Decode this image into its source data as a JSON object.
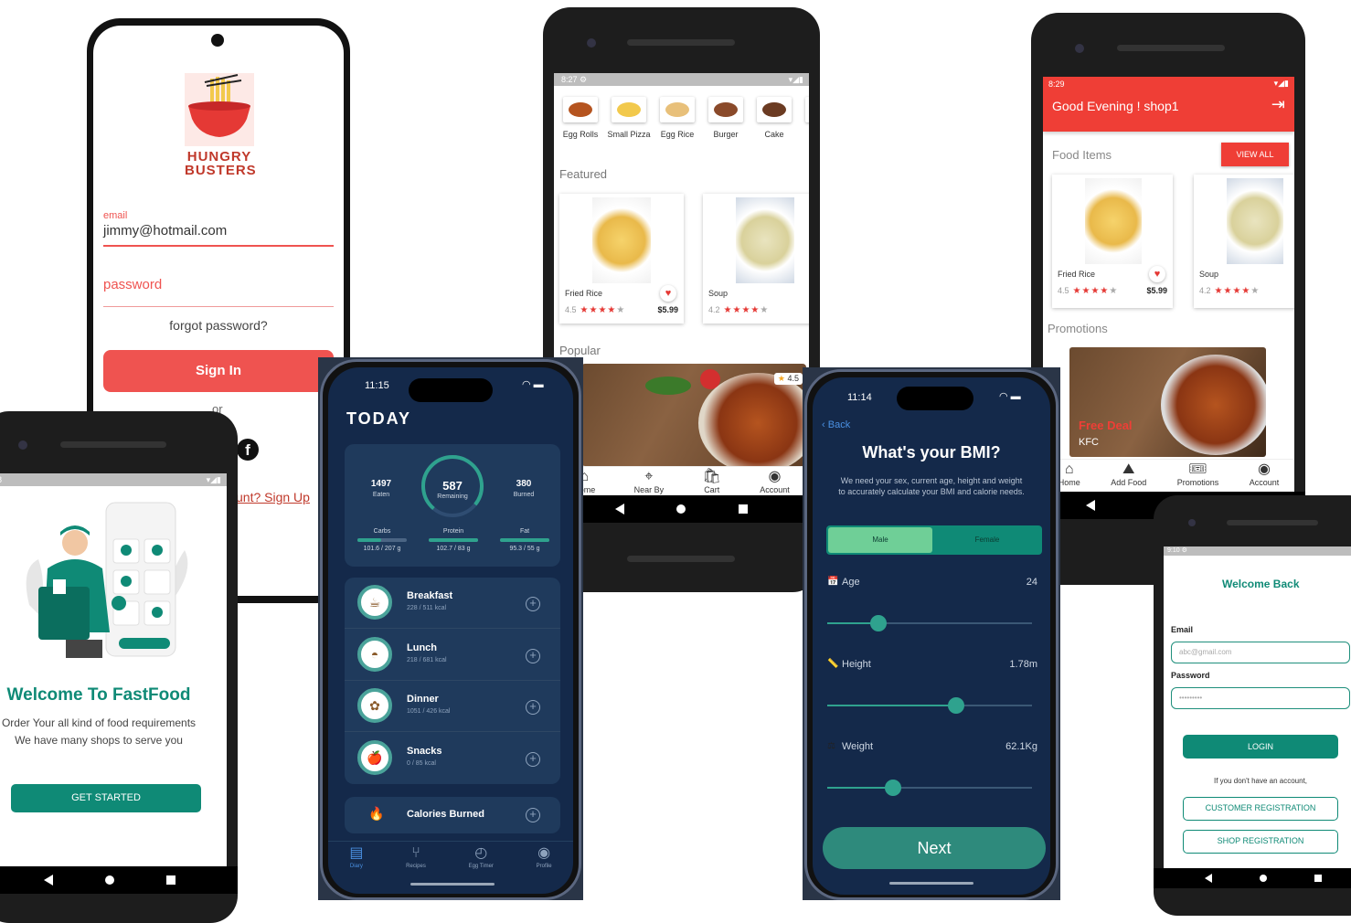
{
  "login": {
    "brand_line1": "HUNGRY",
    "brand_line2": "BUSTERS",
    "email_label": "email",
    "email_value": "jimmy@hotmail.com",
    "password_placeholder": "password",
    "forgot": "forgot password?",
    "signin": "Sign In",
    "or": "or",
    "signup": "unt? Sign Up"
  },
  "menu1": {
    "status_time": "8:27",
    "categories": [
      "Egg Rolls",
      "Small Pizza",
      "Egg Rice",
      "Burger",
      "Cake",
      "Cu"
    ],
    "featured_title": "Featured",
    "items": [
      {
        "name": "Fried Rice",
        "rating": "4.5",
        "price": "$5.99"
      },
      {
        "name": "Soup",
        "rating": "4.2",
        "price": "$"
      }
    ],
    "popular_title": "Popular",
    "popular_rating": "4.5",
    "nav": [
      "Home",
      "Near By",
      "Cart",
      "Account"
    ]
  },
  "shop": {
    "status_time": "8:29",
    "greeting": "Good Evening ! shop1",
    "food_items_title": "Food Items",
    "view_all": "VIEW ALL",
    "items": [
      {
        "name": "Fried Rice",
        "rating": "4.5",
        "price": "$5.99"
      },
      {
        "name": "Soup",
        "rating": "4.2",
        "price": "$"
      }
    ],
    "promotions_title": "Promotions",
    "promo_deal": "Free Deal",
    "promo_brand": "KFC",
    "nav": [
      "Home",
      "Add Food",
      "Promotions",
      "Account"
    ]
  },
  "welcome": {
    "status_time": "08",
    "title": "Welcome To FastFood",
    "line1": "Order Your all kind of food requirements",
    "line2": "We have many shops to serve you",
    "cta": "GET STARTED"
  },
  "diary": {
    "time": "11:15",
    "title": "TODAY",
    "eaten_value": "1497",
    "eaten_label": "Eaten",
    "remaining_value": "587",
    "remaining_label": "Remaining",
    "burned_value": "380",
    "burned_label": "Burned",
    "macros": [
      {
        "name": "Carbs",
        "value": "101.6 / 207 g",
        "fill": 0.49
      },
      {
        "name": "Protein",
        "value": "102.7 / 83 g",
        "fill": 1.0
      },
      {
        "name": "Fat",
        "value": "95.3 / 55 g",
        "fill": 1.0
      }
    ],
    "meals": [
      {
        "name": "Breakfast",
        "kcal": "228 / 511 kcal",
        "icon": "coffee-icon"
      },
      {
        "name": "Lunch",
        "kcal": "218 / 681 kcal",
        "icon": "bowl-icon"
      },
      {
        "name": "Dinner",
        "kcal": "1051 / 426 kcal",
        "icon": "salad-icon"
      },
      {
        "name": "Snacks",
        "kcal": "0 / 85 kcal",
        "icon": "apple-icon"
      }
    ],
    "calories_burned": "Calories Burned",
    "tabs": [
      "Diary",
      "Recipes",
      "Egg Timer",
      "Profile"
    ]
  },
  "bmi": {
    "time": "11:14",
    "back": "Back",
    "title": "What's your BMI?",
    "subtitle1": "We need your sex, current age, height and weight",
    "subtitle2": "to accurately calculate your BMI and calorie needs.",
    "male": "Male",
    "female": "Female",
    "sliders": [
      {
        "label": "Age",
        "value": "24",
        "level": 0.25
      },
      {
        "label": "Height",
        "value": "1.78m",
        "level": 0.63
      },
      {
        "label": "Weight",
        "value": "62.1Kg",
        "level": 0.32
      }
    ],
    "next": "Next"
  },
  "signin": {
    "status_time": "9:10",
    "title": "Welcome Back",
    "email_label": "Email",
    "email_placeholder": "abc@gmail.com",
    "password_label": "Password",
    "password_placeholder": "•••••••••",
    "login": "LOGIN",
    "no_account": "If you don't have an account,",
    "customer": "CUSTOMER REGISTRATION",
    "shop": "SHOP REGISTRATION"
  },
  "colors": {
    "coral": "#ef5350",
    "teal": "#0f8a76",
    "navy": "#14294a",
    "mint": "#2fa28e",
    "red_header": "#ef3e36"
  }
}
